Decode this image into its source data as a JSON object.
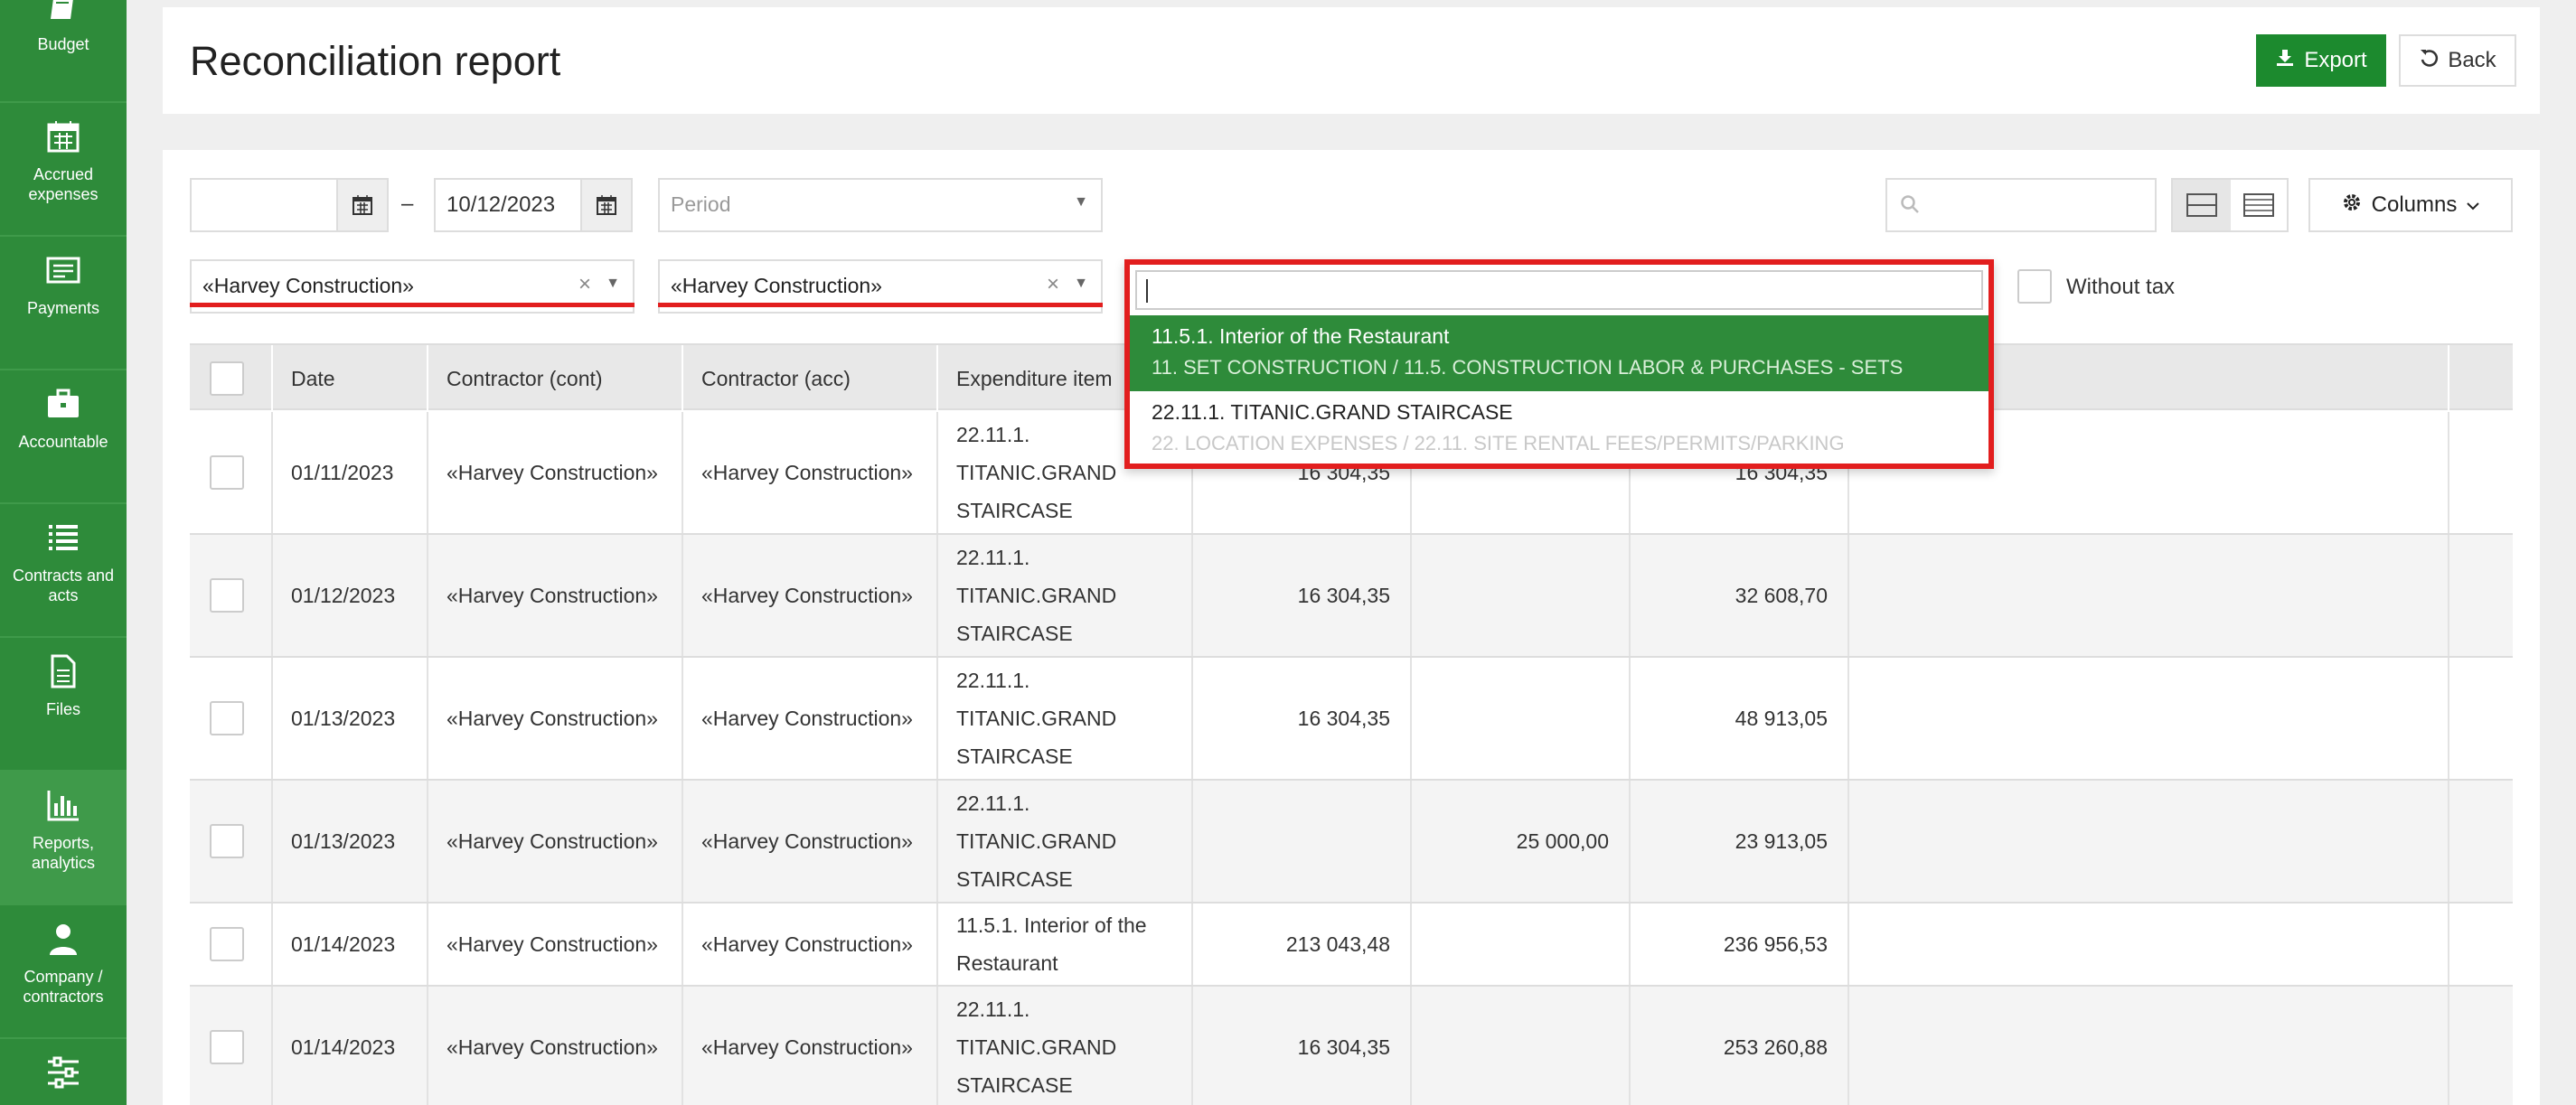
{
  "sidebar": {
    "items": [
      {
        "label": "Budget",
        "icon": "budget-icon"
      },
      {
        "label": "Accrued expenses",
        "icon": "calendar-icon"
      },
      {
        "label": "Payments",
        "icon": "payments-icon"
      },
      {
        "label": "Accountable",
        "icon": "briefcase-icon"
      },
      {
        "label": "Contracts and acts",
        "icon": "list-icon"
      },
      {
        "label": "Files",
        "icon": "file-icon"
      },
      {
        "label": "Reports, analytics",
        "icon": "bar-chart-icon"
      },
      {
        "label": "Company / contractors",
        "icon": "user-icon"
      },
      {
        "label": "",
        "icon": "sliders-icon"
      }
    ]
  },
  "header": {
    "title": "Reconciliation report",
    "export_label": "Export",
    "back_label": "Back"
  },
  "filters": {
    "date_from": "",
    "date_separator": "–",
    "date_to": "10/12/2023",
    "period_placeholder": "Period",
    "contractor_cont": "«Harvey Construction»",
    "contractor_acc": "«Harvey Construction»",
    "clear_glyph": "×",
    "without_tax_label": "Without tax",
    "columns_label": "Columns"
  },
  "dropdown": {
    "search_value": "",
    "options": [
      {
        "title": "11.5.1. Interior of the Restaurant",
        "path": "11. SET CONSTRUCTION / 11.5. CONSTRUCTION LABOR & PURCHASES - SETS",
        "selected": true
      },
      {
        "title": "22.11.1. TITANIC.GRAND STAIRCASE",
        "path": "22. LOCATION EXPENSES / 22.11. SITE RENTAL FEES/PERMITS/PARKING",
        "selected": false
      }
    ]
  },
  "table": {
    "headers": [
      "Date",
      "Contractor (cont)",
      "Contractor (acc)",
      "Expenditure item"
    ],
    "rows": [
      {
        "date": "01/11/2023",
        "cont": "«Harvey Construction»",
        "acc": "«Harvey Construction»",
        "item": "22.11.1. TITANIC.GRAND STAIRCASE",
        "debit": "16 304,35",
        "credit": "",
        "balance": "16 304,35"
      },
      {
        "date": "01/12/2023",
        "cont": "«Harvey Construction»",
        "acc": "«Harvey Construction»",
        "item": "22.11.1. TITANIC.GRAND STAIRCASE",
        "debit": "16 304,35",
        "credit": "",
        "balance": "32 608,70"
      },
      {
        "date": "01/13/2023",
        "cont": "«Harvey Construction»",
        "acc": "«Harvey Construction»",
        "item": "22.11.1. TITANIC.GRAND STAIRCASE",
        "debit": "16 304,35",
        "credit": "",
        "balance": "48 913,05"
      },
      {
        "date": "01/13/2023",
        "cont": "«Harvey Construction»",
        "acc": "«Harvey Construction»",
        "item": "22.11.1. TITANIC.GRAND STAIRCASE",
        "debit": "",
        "credit": "25 000,00",
        "balance": "23 913,05"
      },
      {
        "date": "01/14/2023",
        "cont": "«Harvey Construction»",
        "acc": "«Harvey Construction»",
        "item": "11.5.1. Interior of the Restaurant",
        "debit": "213 043,48",
        "credit": "",
        "balance": "236 956,53"
      },
      {
        "date": "01/14/2023",
        "cont": "«Harvey Construction»",
        "acc": "«Harvey Construction»",
        "item": "22.11.1. TITANIC.GRAND STAIRCASE",
        "debit": "16 304,35",
        "credit": "",
        "balance": "253 260,88"
      }
    ]
  },
  "colors": {
    "brand_green": "#2e8b3a",
    "button_green": "#1c8a2e",
    "highlight_red": "#e21e1e"
  }
}
